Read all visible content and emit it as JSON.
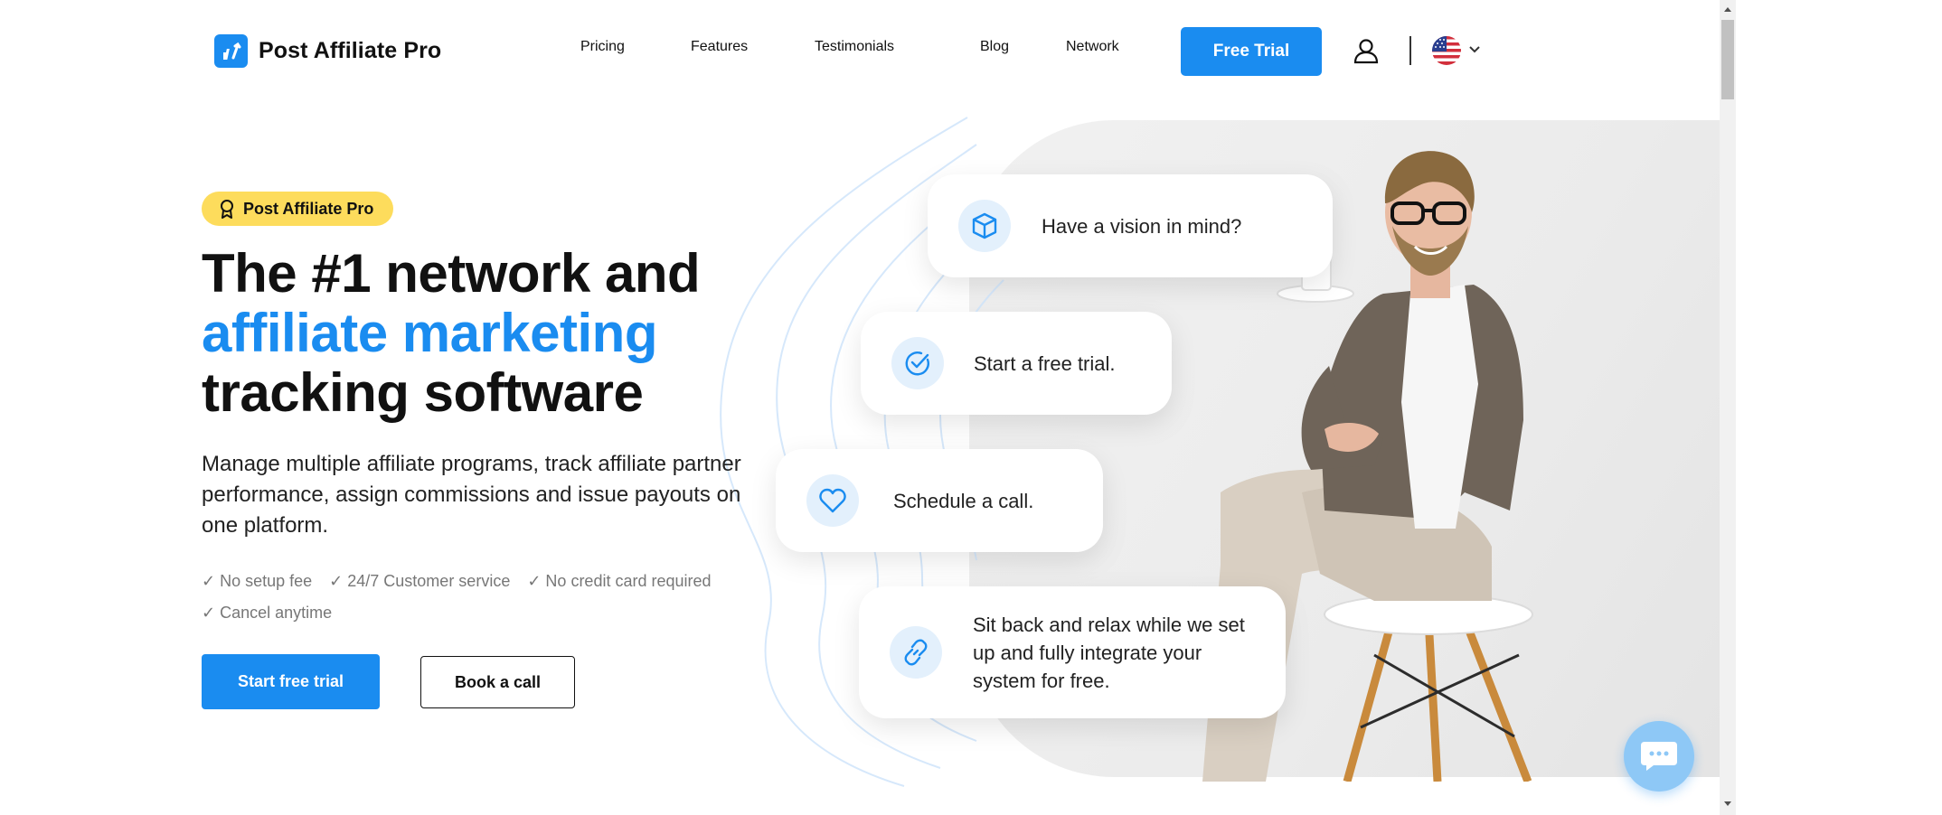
{
  "header": {
    "logo_text": "Post Affiliate Pro",
    "nav": [
      "Pricing",
      "Features",
      "Testimonials",
      "Blog",
      "Network"
    ],
    "cta_label": "Free Trial",
    "icons": {
      "account": "user-icon",
      "language": "us-flag-icon",
      "dropdown": "chevron-down-icon"
    }
  },
  "hero": {
    "badge": "Post Affiliate Pro",
    "headline_line1": "The #1 network and",
    "headline_line2": "affiliate marketing",
    "headline_line3": "tracking software",
    "subtext": "Manage multiple affiliate programs, track affiliate partner performance, assign commissions and issue payouts on one platform.",
    "features": [
      "✓ No setup fee",
      "✓ 24/7 Customer service",
      "✓ No credit card required",
      "✓ Cancel anytime"
    ],
    "primary_button": "Start free trial",
    "secondary_button": "Book a call"
  },
  "steps": [
    {
      "text": "Have a vision in mind?",
      "icon": "cube-icon"
    },
    {
      "text": "Start a free trial.",
      "icon": "check-circle-icon"
    },
    {
      "text": "Schedule a call.",
      "icon": "heart-icon"
    },
    {
      "text": "Sit back and relax while we set up and fully integrate your system for free.",
      "icon": "link-icon"
    }
  ],
  "colors": {
    "accent": "#1a8cf0",
    "badge": "#fddc5c",
    "icon_bg": "#e3f0fc"
  }
}
